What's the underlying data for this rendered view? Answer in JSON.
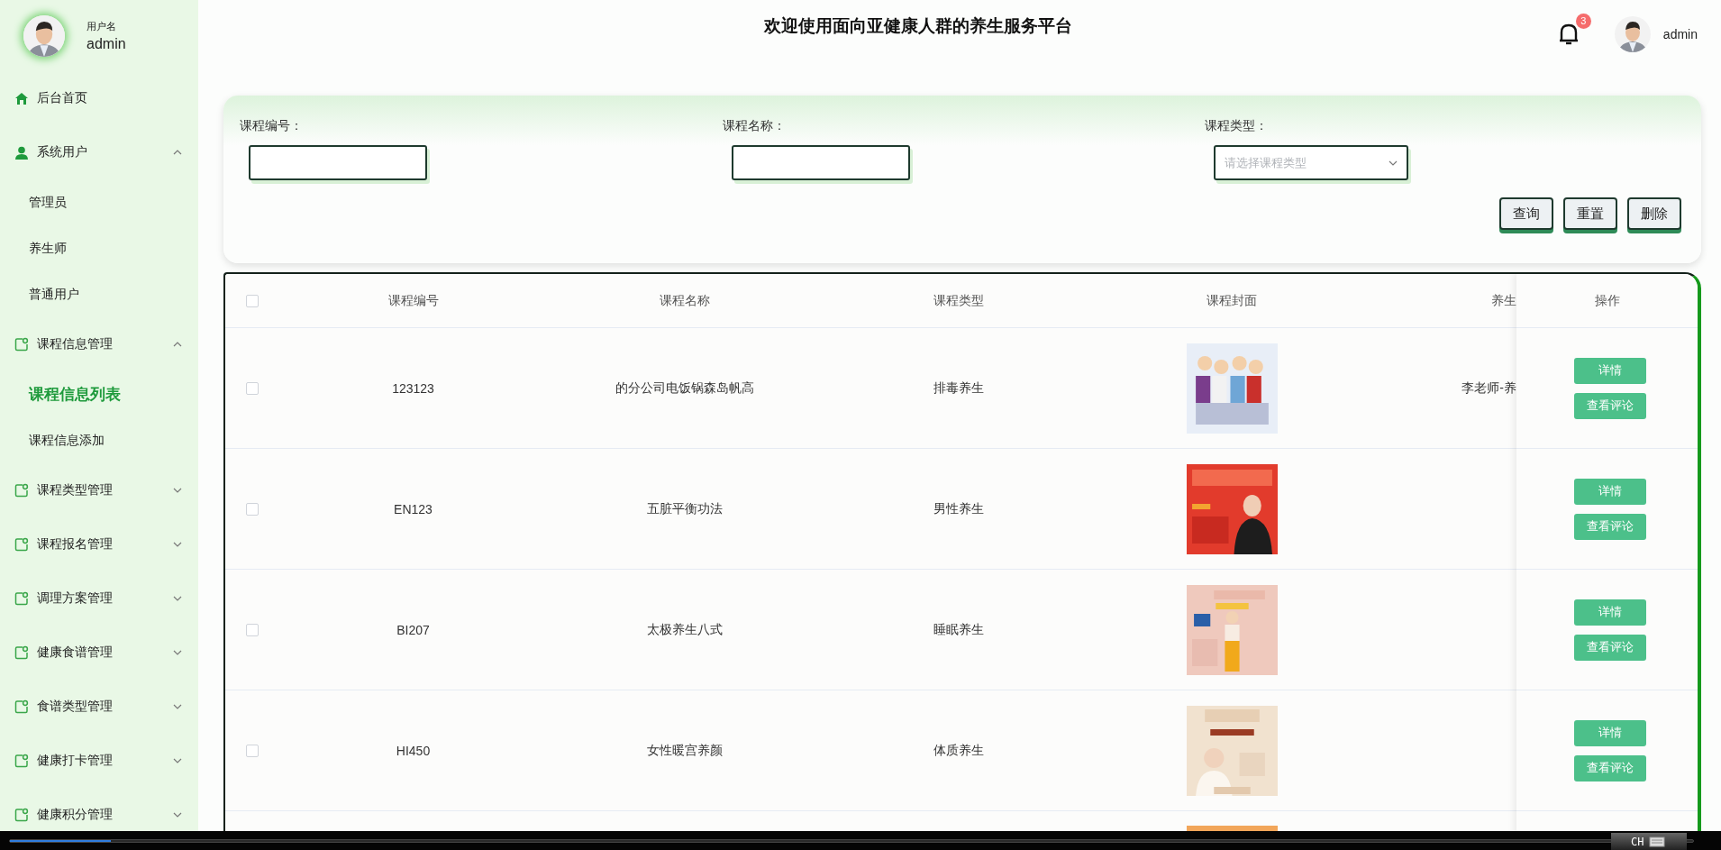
{
  "sidebar": {
    "user_label": "用户名",
    "username": "admin",
    "items": [
      {
        "label": "后台首页",
        "kind": "home"
      },
      {
        "label": "系统用户",
        "kind": "user",
        "expanded": true,
        "children": [
          {
            "label": "管理员",
            "selected": false
          },
          {
            "label": "养生师",
            "selected": false
          },
          {
            "label": "普通用户",
            "selected": false
          }
        ]
      },
      {
        "label": "课程信息管理",
        "kind": "folder",
        "expanded": true,
        "children": [
          {
            "label": "课程信息列表",
            "selected": true
          },
          {
            "label": "课程信息添加",
            "selected": false
          }
        ]
      },
      {
        "label": "课程类型管理",
        "kind": "folder",
        "expanded": false
      },
      {
        "label": "课程报名管理",
        "kind": "folder",
        "expanded": false
      },
      {
        "label": "调理方案管理",
        "kind": "folder",
        "expanded": false
      },
      {
        "label": "健康食谱管理",
        "kind": "folder",
        "expanded": false
      },
      {
        "label": "食谱类型管理",
        "kind": "folder",
        "expanded": false
      },
      {
        "label": "健康打卡管理",
        "kind": "folder",
        "expanded": false
      },
      {
        "label": "健康积分管理",
        "kind": "folder",
        "expanded": false
      }
    ]
  },
  "header": {
    "title": "欢迎使用面向亚健康人群的养生服务平台",
    "notification_count": "3",
    "username": "admin"
  },
  "search": {
    "fields": [
      {
        "label": "课程编号：",
        "kind": "input"
      },
      {
        "label": "课程名称：",
        "kind": "input"
      },
      {
        "label": "课程类型：",
        "kind": "select",
        "placeholder": "请选择课程类型"
      }
    ],
    "buttons": [
      "查询",
      "重置",
      "删除"
    ]
  },
  "table": {
    "select_all_checked": false,
    "columns": [
      "课程编号",
      "课程名称",
      "课程类型",
      "课程封面",
      "养生",
      "操作"
    ],
    "rows": [
      {
        "checked": false,
        "code": "123123",
        "name": "的分公司电饭锅森岛帆高",
        "type": "排毒养生",
        "teacher": "李老师-养",
        "actions": [
          "详情",
          "查看评论"
        ]
      },
      {
        "checked": false,
        "code": "EN123",
        "name": "五脏平衡功法",
        "type": "男性养生",
        "actions": [
          "详情",
          "查看评论"
        ]
      },
      {
        "checked": false,
        "code": "BI207",
        "name": "太极养生八式",
        "type": "睡眠养生",
        "actions": [
          "详情",
          "查看评论"
        ]
      },
      {
        "checked": false,
        "code": "HI450",
        "name": "女性暖宫养颜",
        "type": "体质养生",
        "actions": [
          "详情",
          "查看评论"
        ]
      }
    ]
  },
  "playback": {
    "level": 0.06
  },
  "ime": {
    "label": "CH"
  }
}
